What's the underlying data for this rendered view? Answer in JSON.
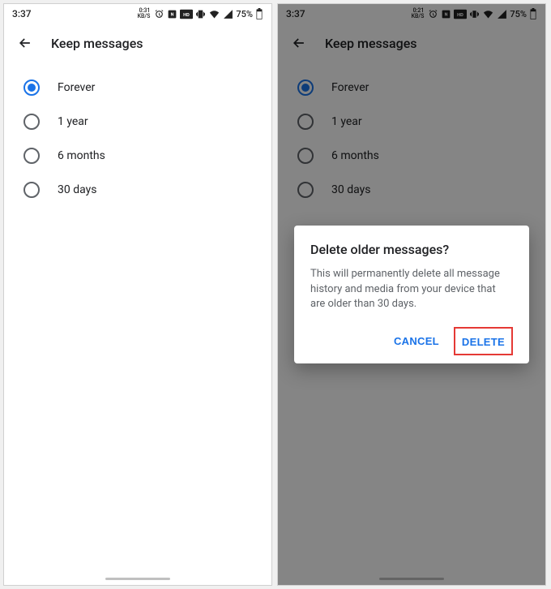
{
  "status": {
    "time": "3:37",
    "net_label_a": "0:31",
    "net_label_b": "0:21",
    "net_unit": "KB/S",
    "battery_pct": "75%"
  },
  "header": {
    "title": "Keep messages"
  },
  "options": [
    {
      "label": "Forever",
      "selected": true
    },
    {
      "label": "1 year",
      "selected": false
    },
    {
      "label": "6 months",
      "selected": false
    },
    {
      "label": "30 days",
      "selected": false
    }
  ],
  "dialog": {
    "title": "Delete older messages?",
    "body": "This will permanently delete all message history and media from your device that are older than 30 days.",
    "cancel": "CANCEL",
    "delete": "DELETE"
  }
}
